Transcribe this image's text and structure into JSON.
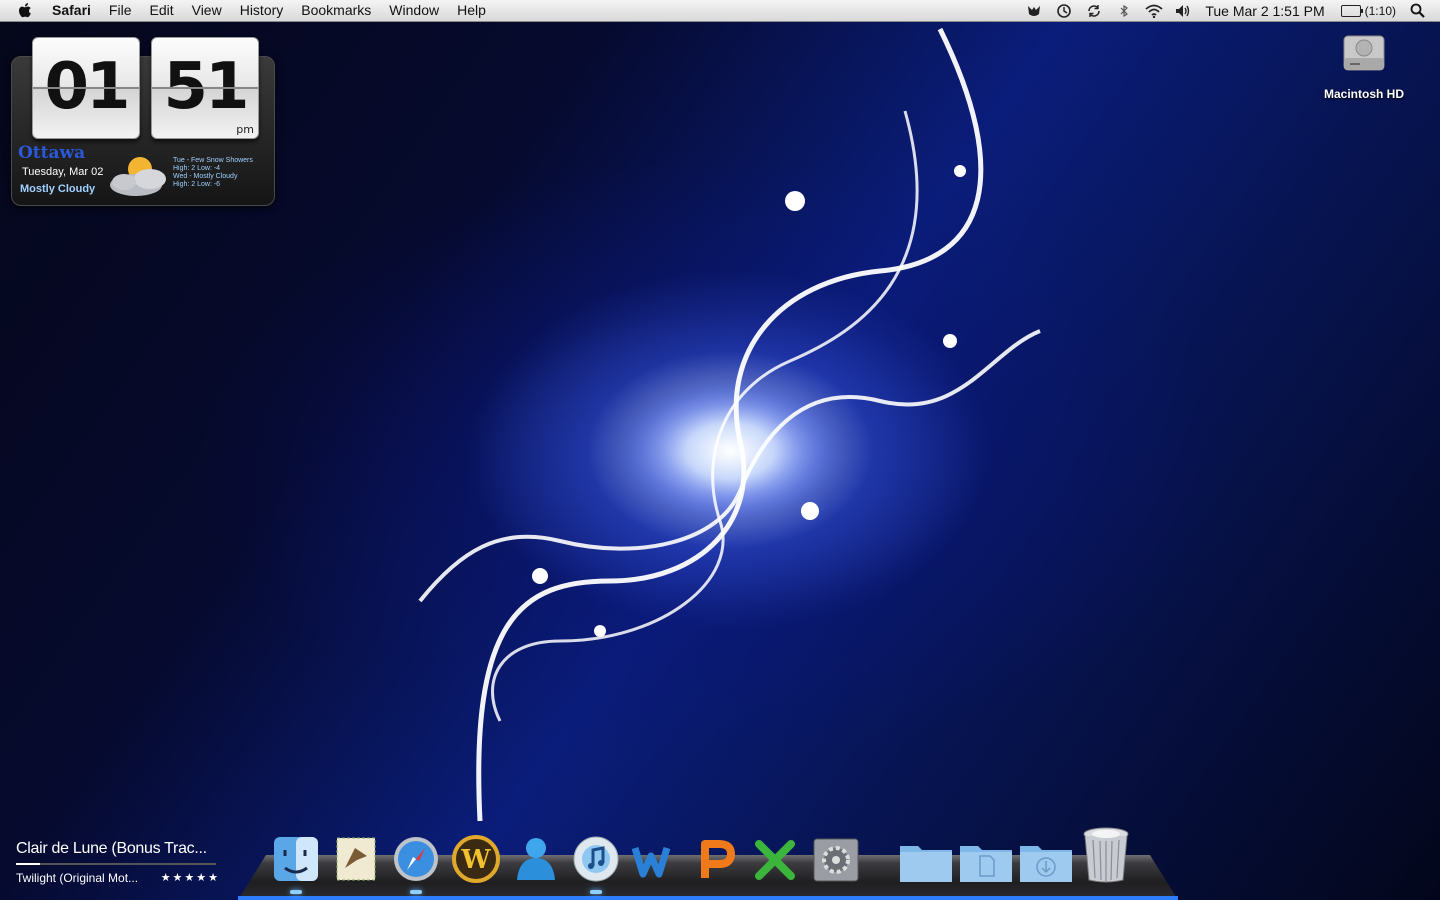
{
  "menubar": {
    "app_name": "Safari",
    "menus": [
      "File",
      "Edit",
      "View",
      "History",
      "Bookmarks",
      "Window",
      "Help"
    ],
    "clock": "Tue Mar 2  1:51 PM",
    "battery_time": "(1:10)",
    "status_icons": [
      "growl-icon",
      "time-machine-icon",
      "sync-icon",
      "bluetooth-icon",
      "wifi-icon",
      "volume-icon"
    ]
  },
  "widget": {
    "hours": "01",
    "minutes": "51",
    "ampm": "pm",
    "city": "Ottawa",
    "date": "Tuesday, Mar 02",
    "condition": "Mostly Cloudy",
    "forecast": [
      "Tue - Few Snow Showers",
      "High: 2 Low: -4",
      "Wed - Mostly Cloudy",
      "High: 2 Low: -6"
    ]
  },
  "desktop": {
    "hd_label": "Macintosh HD"
  },
  "now_playing": {
    "title": "Clair de Lune (Bonus Trac...",
    "album": "Twilight (Original Mot...",
    "rating": "★★★★★",
    "progress": 0.12
  },
  "dock": {
    "items": [
      "finder-icon",
      "mail-icon",
      "safari-icon",
      "world-of-warcraft-icon",
      "messenger-icon",
      "itunes-icon",
      "word-icon",
      "powerpoint-icon",
      "excel-icon",
      "system-preferences-icon",
      "applications-folder-icon",
      "documents-folder-icon",
      "downloads-folder-icon",
      "trash-icon"
    ]
  },
  "colors": {
    "accent": "#2f7dff",
    "weather_city": "#2a58d8"
  }
}
